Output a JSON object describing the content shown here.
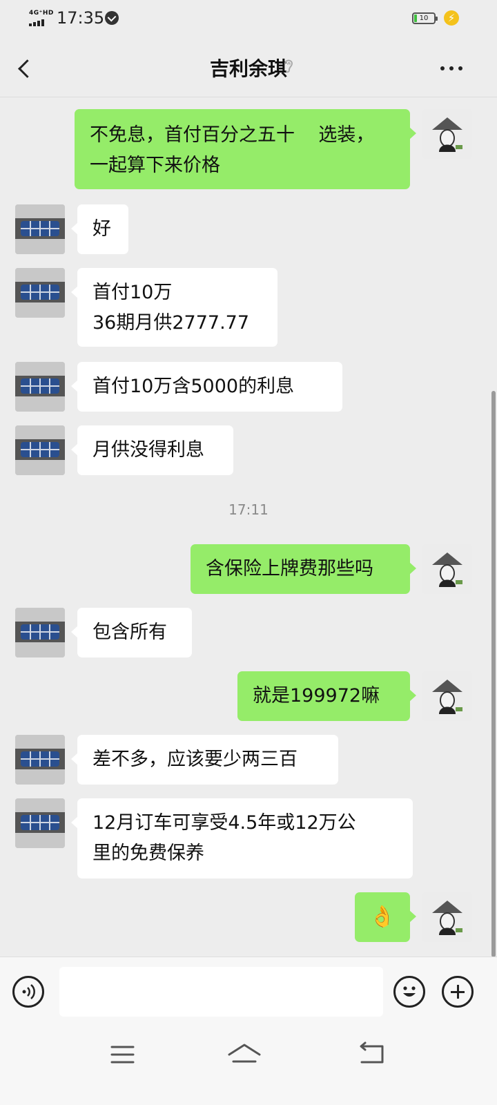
{
  "status_bar": {
    "network": "4G⁺HD",
    "time": "17:35",
    "battery": "10"
  },
  "header": {
    "title": "吉利余琪"
  },
  "messages": [
    {
      "side": "right",
      "text": "不免息，首付百分之五十    选装，\n一起算下来价格"
    },
    {
      "side": "left",
      "text": "好"
    },
    {
      "side": "left",
      "text": "首付10万\n36期月供2777.77"
    },
    {
      "side": "left",
      "text": "首付10万含5000的利息"
    },
    {
      "side": "left",
      "text": "月供没得利息"
    },
    {
      "side": "right",
      "text": "含保险上牌费那些吗"
    },
    {
      "side": "left",
      "text": "包含所有"
    },
    {
      "side": "right",
      "text": "就是199972嘛"
    },
    {
      "side": "left",
      "text": "差不多，应该要少两三百"
    },
    {
      "side": "left",
      "text": "12月订车可享受4.5年或12万公\n里的免费保养"
    },
    {
      "side": "right",
      "text": "👌"
    }
  ],
  "timestamp": "17:11",
  "input": {
    "value": ""
  },
  "icons": {
    "back": "back-arrow-icon",
    "ear": "ear-icon",
    "more": "more-icon",
    "voice": "voice-icon",
    "emoji": "emoji-icon",
    "plus": "plus-icon",
    "nav_menu": "menu-icon",
    "nav_home": "home-icon",
    "nav_back": "return-icon"
  }
}
